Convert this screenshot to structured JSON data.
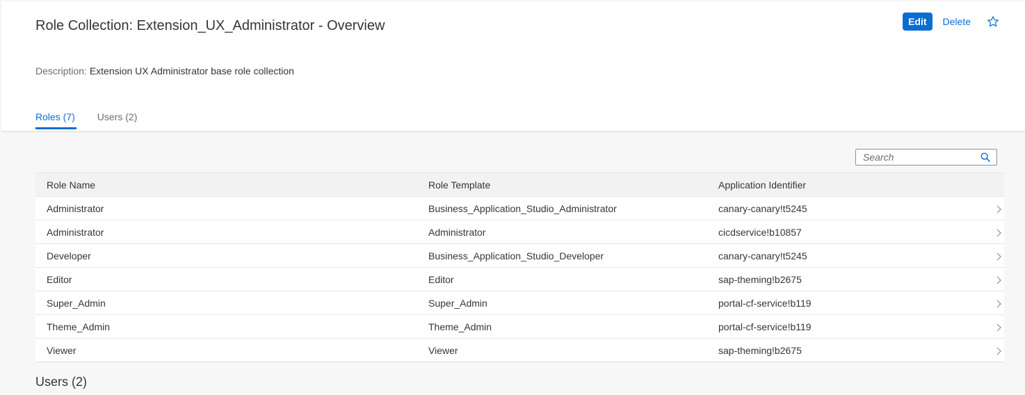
{
  "page": {
    "title": "Role Collection: Extension_UX_Administrator - Overview",
    "actions": {
      "edit_label": "Edit",
      "delete_label": "Delete"
    },
    "description": {
      "label": "Description:",
      "value": "Extension UX Administrator base role collection"
    },
    "tabs": [
      {
        "label": "Roles (7)",
        "active": true
      },
      {
        "label": "Users (2)",
        "active": false
      }
    ]
  },
  "roles_table": {
    "search_placeholder": "Search",
    "columns": [
      "Role Name",
      "Role Template",
      "Application Identifier"
    ],
    "rows": [
      [
        "Administrator",
        "Business_Application_Studio_Administrator",
        "canary-canary!t5245"
      ],
      [
        "Administrator",
        "Administrator",
        "cicdservice!b10857"
      ],
      [
        "Developer",
        "Business_Application_Studio_Developer",
        "canary-canary!t5245"
      ],
      [
        "Editor",
        "Editor",
        "sap-theming!b2675"
      ],
      [
        "Super_Admin",
        "Super_Admin",
        "portal-cf-service!b119"
      ],
      [
        "Theme_Admin",
        "Theme_Admin",
        "portal-cf-service!b119"
      ],
      [
        "Viewer",
        "Viewer",
        "sap-theming!b2675"
      ]
    ]
  },
  "users_section": {
    "title": "Users (2)"
  },
  "colors": {
    "accent": "#0a6ed1",
    "text": "#32363a",
    "muted_text": "#6a6d70",
    "background": "#f7f7f7"
  },
  "icons": {
    "favorite": "star-icon",
    "search": "search-icon",
    "row_navigation": "chevron-right-icon"
  }
}
